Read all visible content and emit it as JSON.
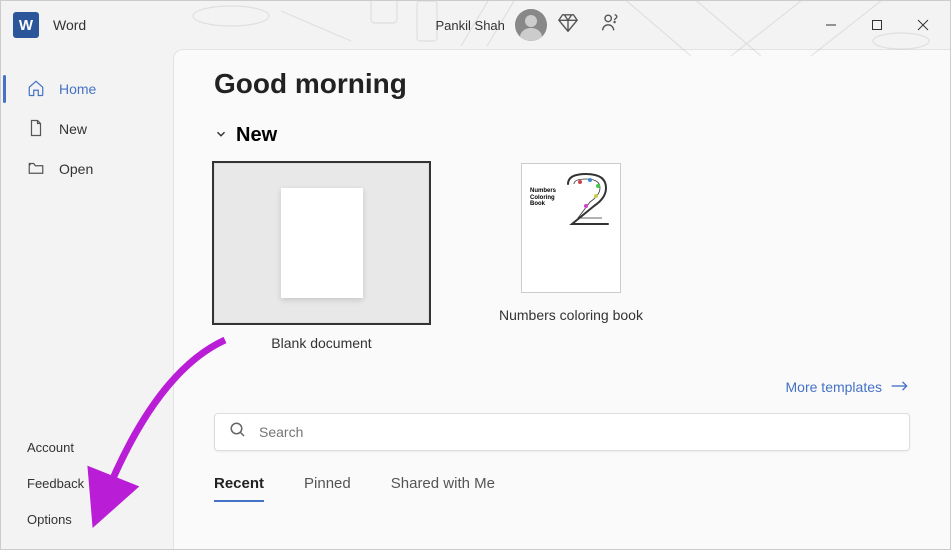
{
  "titlebar": {
    "app_name": "Word",
    "user_name": "Pankil Shah"
  },
  "sidebar": {
    "top": [
      {
        "label": "Home",
        "icon": "home",
        "active": true
      },
      {
        "label": "New",
        "icon": "document",
        "active": false
      },
      {
        "label": "Open",
        "icon": "folder",
        "active": false
      }
    ],
    "bottom": [
      {
        "label": "Account"
      },
      {
        "label": "Feedback"
      },
      {
        "label": "Options"
      }
    ]
  },
  "main": {
    "greeting": "Good morning",
    "section_new_title": "New",
    "templates": [
      {
        "label": "Blank document",
        "type": "blank",
        "selected": true
      },
      {
        "label": "Numbers coloring book",
        "type": "coloring",
        "selected": false,
        "thumb_text": "Numbers\nColoring\nBook"
      }
    ],
    "more_templates_label": "More templates",
    "search_placeholder": "Search",
    "tabs": [
      {
        "label": "Recent",
        "active": true
      },
      {
        "label": "Pinned",
        "active": false
      },
      {
        "label": "Shared with Me",
        "active": false
      }
    ]
  },
  "colors": {
    "accent": "#4472c4",
    "annotation_arrow": "#b91ed6"
  }
}
